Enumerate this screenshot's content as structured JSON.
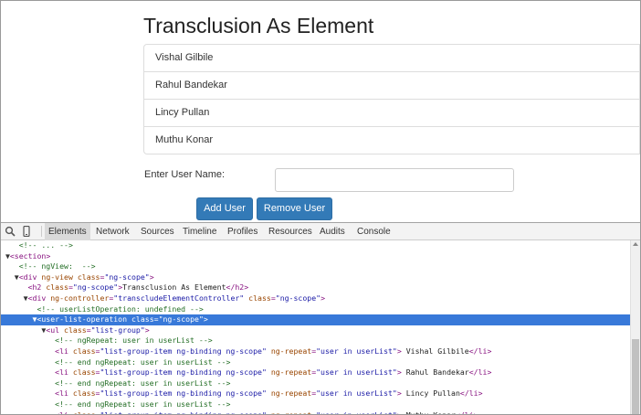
{
  "page": {
    "title": "Transclusion As Element",
    "users": [
      "Vishal Gilbile",
      "Rahul Bandekar",
      "Lincy Pullan",
      "Muthu Konar"
    ],
    "input_label": "Enter User Name:",
    "input_value": "",
    "add_button": "Add User",
    "remove_button": "Remove User"
  },
  "devtools": {
    "tabs": [
      "Elements",
      "Network",
      "Sources",
      "Timeline",
      "Profiles",
      "Resources",
      "Audits",
      "Console"
    ],
    "active_tab": "Elements",
    "dom_lines": [
      {
        "text": "    <!-- ... -->",
        "sel": false
      },
      {
        "text": " ▼<section>",
        "sel": false
      },
      {
        "text": "    <!-- ngView:  -->",
        "sel": false
      },
      {
        "text": "   ▼<div ng-view class=\"ng-scope\">",
        "sel": false
      },
      {
        "text": "      <h2 class=\"ng-scope\">Transclusion As Element</h2>",
        "sel": false
      },
      {
        "text": "     ▼<div ng-controller=\"transcludeElementController\" class=\"ng-scope\">",
        "sel": false
      },
      {
        "text": "        <!-- userListOperation: undefined -->",
        "sel": false
      },
      {
        "text": "       ▼<user-list-operation class=\"ng-scope\">",
        "sel": true
      },
      {
        "text": "         ▼<ul class=\"list-group\">",
        "sel": false
      },
      {
        "text": "            <!-- ngRepeat: user in userList -->",
        "sel": false
      },
      {
        "text": "            <li class=\"list-group-item ng-binding ng-scope\" ng-repeat=\"user in userList\"> Vishal Gilbile</li>",
        "sel": false
      },
      {
        "text": "            <!-- end ngRepeat: user in userList -->",
        "sel": false
      },
      {
        "text": "            <li class=\"list-group-item ng-binding ng-scope\" ng-repeat=\"user in userList\"> Rahul Bandekar</li>",
        "sel": false
      },
      {
        "text": "            <!-- end ngRepeat: user in userList -->",
        "sel": false
      },
      {
        "text": "            <li class=\"list-group-item ng-binding ng-scope\" ng-repeat=\"user in userList\"> Lincy Pullan</li>",
        "sel": false
      },
      {
        "text": "            <!-- end ngRepeat: user in userList -->",
        "sel": false
      },
      {
        "text": "            <li class=\"list-group-item ng-binding ng-scope\" ng-repeat=\"user in userList\"> Muthu Konar</li>",
        "sel": false
      }
    ]
  },
  "icons": {
    "inspect": "magnifier-icon",
    "device": "mobile-device-icon"
  },
  "colors": {
    "button_blue": "#337ab7",
    "selection_blue": "#3879d9",
    "tag_purple": "#881280",
    "attr_brown": "#994500",
    "value_blue": "#1a1aa6",
    "comment_green": "#236e25"
  }
}
